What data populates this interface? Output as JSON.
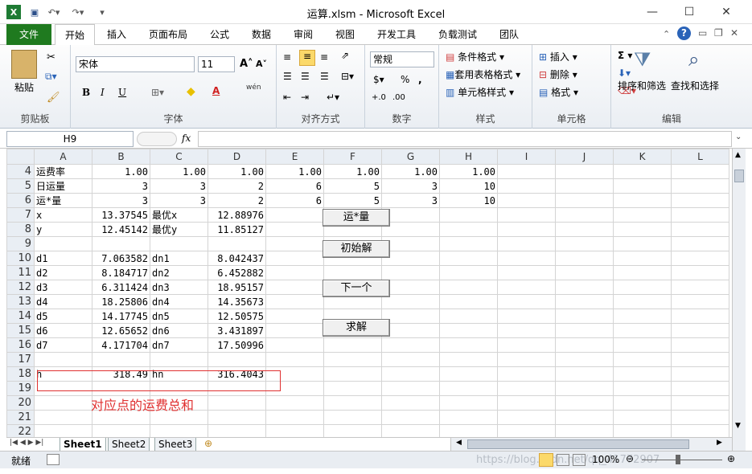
{
  "window": {
    "title": "运算.xlsm  -  Microsoft Excel"
  },
  "tabs": [
    "文件",
    "开始",
    "插入",
    "页面布局",
    "公式",
    "数据",
    "审阅",
    "视图",
    "开发工具",
    "负载测试",
    "团队"
  ],
  "ribbon": {
    "clipboard": {
      "paste": "粘贴",
      "label": "剪贴板"
    },
    "font": {
      "name": "宋体",
      "size": "11",
      "bold": "B",
      "italic": "I",
      "underline": "U",
      "wen": "wén",
      "label": "字体"
    },
    "align": {
      "label": "对齐方式"
    },
    "number": {
      "format": "常规",
      "label": "数字"
    },
    "styles": {
      "cond": "条件格式",
      "table": "套用表格格式",
      "cell": "单元格样式",
      "label": "样式"
    },
    "cells": {
      "insert": "插入",
      "delete": "删除",
      "format": "格式",
      "label": "单元格"
    },
    "edit": {
      "sort": "排序和筛选",
      "find": "查找和选择",
      "label": "编辑"
    }
  },
  "formula": {
    "namebox": "H9",
    "fx": "fx",
    "value": ""
  },
  "columns": [
    "A",
    "B",
    "C",
    "D",
    "E",
    "F",
    "G",
    "H",
    "I",
    "J",
    "K",
    "L"
  ],
  "rows": [
    {
      "n": "4",
      "c": [
        "运费率",
        "1.00",
        "1.00",
        "1.00",
        "1.00",
        "1.00",
        "1.00",
        "1.00",
        "",
        "",
        "",
        ""
      ]
    },
    {
      "n": "5",
      "c": [
        "日运量",
        "3",
        "3",
        "2",
        "6",
        "5",
        "3",
        "10",
        "",
        "",
        "",
        ""
      ]
    },
    {
      "n": "6",
      "c": [
        "运*量",
        "3",
        "3",
        "2",
        "6",
        "5",
        "3",
        "10",
        "",
        "",
        "",
        ""
      ]
    },
    {
      "n": "7",
      "c": [
        "x",
        "13.37545",
        "最优x",
        "12.88976",
        "",
        "",
        "",
        "",
        "",
        "",
        "",
        ""
      ]
    },
    {
      "n": "8",
      "c": [
        "y",
        "12.45142",
        "最优y",
        "11.85127",
        "",
        "",
        "",
        "",
        "",
        "",
        "",
        ""
      ]
    },
    {
      "n": "9",
      "c": [
        "",
        "",
        "",
        "",
        "",
        "",
        "",
        "",
        "",
        "",
        "",
        ""
      ]
    },
    {
      "n": "10",
      "c": [
        "d1",
        "7.063582",
        "dn1",
        "8.042437",
        "",
        "",
        "",
        "",
        "",
        "",
        "",
        ""
      ]
    },
    {
      "n": "11",
      "c": [
        "d2",
        "8.184717",
        "dn2",
        "6.452882",
        "",
        "",
        "",
        "",
        "",
        "",
        "",
        ""
      ]
    },
    {
      "n": "12",
      "c": [
        "d3",
        "6.311424",
        "dn3",
        "18.95157",
        "",
        "",
        "",
        "",
        "",
        "",
        "",
        ""
      ]
    },
    {
      "n": "13",
      "c": [
        "d4",
        "18.25806",
        "dn4",
        "14.35673",
        "",
        "",
        "",
        "",
        "",
        "",
        "",
        ""
      ]
    },
    {
      "n": "14",
      "c": [
        "d5",
        "14.17745",
        "dn5",
        "12.50575",
        "",
        "",
        "",
        "",
        "",
        "",
        "",
        ""
      ]
    },
    {
      "n": "15",
      "c": [
        "d6",
        "12.65652",
        "dn6",
        "3.431897",
        "",
        "",
        "",
        "",
        "",
        "",
        "",
        ""
      ]
    },
    {
      "n": "16",
      "c": [
        "d7",
        "4.171704",
        "dn7",
        "17.50996",
        "",
        "",
        "",
        "",
        "",
        "",
        "",
        ""
      ]
    },
    {
      "n": "17",
      "c": [
        "",
        "",
        "",
        "",
        "",
        "",
        "",
        "",
        "",
        "",
        "",
        ""
      ]
    },
    {
      "n": "18",
      "c": [
        "h",
        "318.49",
        "hn",
        "316.4043",
        "",
        "",
        "",
        "",
        "",
        "",
        "",
        ""
      ]
    },
    {
      "n": "19",
      "c": [
        "",
        "",
        "",
        "",
        "",
        "",
        "",
        "",
        "",
        "",
        "",
        ""
      ]
    },
    {
      "n": "20",
      "c": [
        "",
        "",
        "",
        "",
        "",
        "",
        "",
        "",
        "",
        "",
        "",
        ""
      ]
    },
    {
      "n": "21",
      "c": [
        "",
        "",
        "",
        "",
        "",
        "",
        "",
        "",
        "",
        "",
        "",
        ""
      ]
    },
    {
      "n": "22",
      "c": [
        "",
        "",
        "",
        "",
        "",
        "",
        "",
        "",
        "",
        "",
        "",
        ""
      ]
    }
  ],
  "buttons": {
    "b1": "运*量",
    "b2": "初始解",
    "b3": "下一个",
    "b4": "求解"
  },
  "annotation": "对应点的运费总和",
  "sheets": [
    "Sheet1",
    "Sheet2",
    "Sheet3"
  ],
  "status": {
    "ready": "就绪",
    "zoom": "100%",
    "watermark": "https://blog.csdn.net/qq_41772907"
  }
}
